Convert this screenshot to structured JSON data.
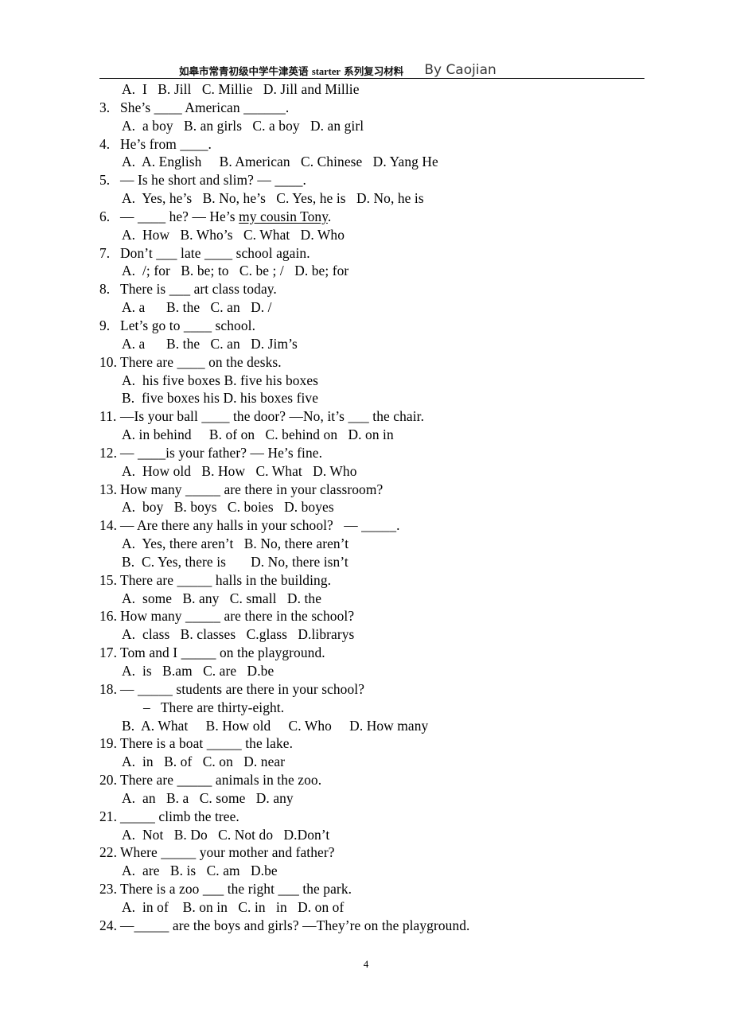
{
  "header": {
    "title_cn_1": "如皋市常青初级中学牛津英语 ",
    "title_latin": "starter",
    "title_cn_2": " 系列复习材料",
    "title_full": "如皋市常青初级中学牛津英语 starter 系列复习材料",
    "author": "By Caojian"
  },
  "footer": {
    "page_number": "4"
  },
  "lines": [
    {
      "kind": "options",
      "text": "A.  I   B. Jill   C. Millie   D. Jill and Millie"
    },
    {
      "kind": "question",
      "num": "3.",
      "text": "She’s ____ American ______."
    },
    {
      "kind": "options",
      "text": "A.  a boy   B. an girls   C. a boy   D. an girl"
    },
    {
      "kind": "question",
      "num": "4.",
      "text": "He’s from ____."
    },
    {
      "kind": "options",
      "text": "A.  A. English     B. American   C. Chinese   D. Yang He"
    },
    {
      "kind": "question",
      "num": "5.",
      "text": "— Is he short and slim? — ____."
    },
    {
      "kind": "options",
      "text": "A.  Yes, he’s   B. No, he’s   C. Yes, he is   D. No, he is"
    },
    {
      "kind": "question",
      "num": "6.",
      "text": "— ____ he? — He’s my cousin Tony."
    },
    {
      "kind": "options",
      "text": "A.  How   B. Who’s   C. What   D. Who"
    },
    {
      "kind": "question",
      "num": "7.",
      "text": "Don’t ___ late ____ school again."
    },
    {
      "kind": "options",
      "text": "A.  /; for   B. be; to   C. be ; /   D. be; for"
    },
    {
      "kind": "question",
      "num": "8.",
      "text": "There is ___ art class today."
    },
    {
      "kind": "options",
      "text": "A. a      B. the   C. an   D. /"
    },
    {
      "kind": "question",
      "num": "9.",
      "text": "Let’s go to ____ school."
    },
    {
      "kind": "options",
      "text": "A. a      B. the   C. an   D. Jim’s"
    },
    {
      "kind": "question",
      "num": "10.",
      "text": "There are ____ on the desks."
    },
    {
      "kind": "options",
      "text": "A.  his five boxes B. five his boxes"
    },
    {
      "kind": "options",
      "text": "B.  five boxes his D. his boxes five"
    },
    {
      "kind": "question",
      "num": "11.",
      "text": "—Is your ball ____ the door? —No, it’s ___ the chair."
    },
    {
      "kind": "options",
      "text": "A. in behind     B. of on   C. behind on   D. on in"
    },
    {
      "kind": "question",
      "num": "12.",
      "text": "— ____is your father? — He’s fine."
    },
    {
      "kind": "options",
      "text": "A.  How old   B. How   C. What   D. Who"
    },
    {
      "kind": "question",
      "num": "13.",
      "text": "How many _____ are there in your classroom?"
    },
    {
      "kind": "options",
      "text": "A.  boy   B. boys   C. boies   D. boyes"
    },
    {
      "kind": "question",
      "num": "14.",
      "text": "— Are there any halls in your school?   — _____."
    },
    {
      "kind": "options",
      "text": "A.  Yes, there aren’t   B. No, there aren’t"
    },
    {
      "kind": "options",
      "text": "B.  C. Yes, there is       D. No, there isn’t"
    },
    {
      "kind": "question",
      "num": "15.",
      "text": "There are _____ halls in the building."
    },
    {
      "kind": "options",
      "text": "A.  some   B. any   C. small   D. the"
    },
    {
      "kind": "question",
      "num": "16.",
      "text": "How many _____ are there in the school?"
    },
    {
      "kind": "options",
      "text": "A.  class   B. classes   C.glass   D.librarys"
    },
    {
      "kind": "question",
      "num": "17.",
      "text": "Tom and I _____ on the playground."
    },
    {
      "kind": "options",
      "text": "A.  is   B.am   C. are   D.be"
    },
    {
      "kind": "question",
      "num": "18.",
      "text": "— _____ students are there in your school?"
    },
    {
      "kind": "sub",
      "text": "–   There are thirty-eight."
    },
    {
      "kind": "options",
      "text": "B.  A. What     B. How old     C. Who     D. How many"
    },
    {
      "kind": "question",
      "num": "19.",
      "text": "There is a boat _____ the lake."
    },
    {
      "kind": "options",
      "text": "A.  in   B. of   C. on   D. near"
    },
    {
      "kind": "question",
      "num": "20.",
      "text": "There are _____ animals in the zoo."
    },
    {
      "kind": "options",
      "text": "A.  an   B. a   C. some   D. any"
    },
    {
      "kind": "question",
      "num": "21.",
      "text": "_____ climb the tree."
    },
    {
      "kind": "options",
      "text": "A.  Not   B. Do   C. Not do   D.Don’t"
    },
    {
      "kind": "question",
      "num": "22.",
      "text": "Where _____ your mother and father?"
    },
    {
      "kind": "options",
      "text": "A.  are   B. is   C. am   D.be"
    },
    {
      "kind": "question",
      "num": "23.",
      "text": "There is a zoo ___ the right ___ the park."
    },
    {
      "kind": "options",
      "text": "A.  in of    B. on in   C. in   in   D. on of"
    },
    {
      "kind": "question",
      "num": "24.",
      "text": "—_____ are the boys and girls? —They’re on the playground."
    }
  ]
}
